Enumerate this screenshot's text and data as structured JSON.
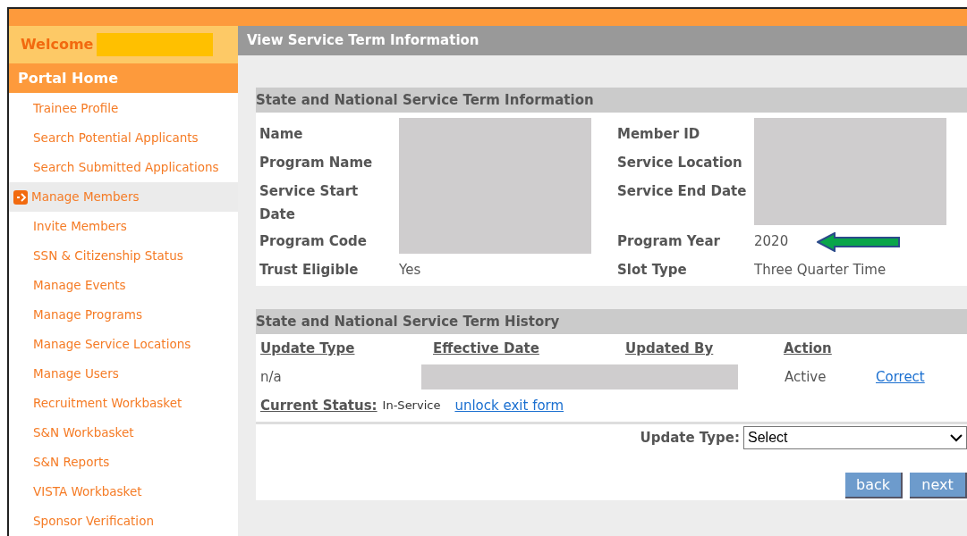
{
  "welcome": {
    "label": "Welcome",
    "name_redacted": true
  },
  "sidebar": {
    "home": "Portal Home",
    "items": [
      {
        "label": "Trainee Profile",
        "selected": false
      },
      {
        "label": "Search Potential Applicants",
        "selected": false
      },
      {
        "label": "Search Submitted Applications",
        "selected": false
      },
      {
        "label": "Manage Members",
        "selected": true
      },
      {
        "label": "Invite Members",
        "selected": false
      },
      {
        "label": "SSN & Citizenship Status",
        "selected": false
      },
      {
        "label": "Manage Events",
        "selected": false
      },
      {
        "label": "Manage Programs",
        "selected": false
      },
      {
        "label": "Manage Service Locations",
        "selected": false
      },
      {
        "label": "Manage Users",
        "selected": false
      },
      {
        "label": "Recruitment Workbasket",
        "selected": false
      },
      {
        "label": "S&N Workbasket",
        "selected": false
      },
      {
        "label": "S&N Reports",
        "selected": false
      },
      {
        "label": "VISTA Workbasket",
        "selected": false
      },
      {
        "label": "Sponsor Verification",
        "selected": false
      }
    ]
  },
  "page_title": "View Service Term Information",
  "info": {
    "title": "State and National Service Term Information",
    "left": [
      {
        "label": "Name",
        "redacted": true
      },
      {
        "label": "Program Name",
        "redacted": true
      },
      {
        "label": "Service Start Date",
        "redacted": true
      },
      {
        "label": "Program Code",
        "redacted": true
      },
      {
        "label": "Trust Eligible",
        "value": "Yes",
        "redacted": false
      }
    ],
    "right": [
      {
        "label": "Member ID",
        "redacted": true
      },
      {
        "label": "Service Location",
        "redacted": true
      },
      {
        "label": "Service End Date",
        "redacted": true
      },
      {
        "label": "Program Year",
        "value": "2020",
        "redacted": false,
        "arrow": true
      },
      {
        "label": "Slot Type",
        "value": "Three Quarter Time",
        "redacted": false
      }
    ]
  },
  "history": {
    "title": "State and National Service Term History",
    "columns": [
      "Update Type",
      "Effective Date",
      "Updated By",
      "Action"
    ],
    "rows": [
      {
        "update_type": "n/a",
        "redacted": true,
        "action": "Active",
        "link": "Correct"
      }
    ],
    "status_label": "Current Status:",
    "status": "In-Service",
    "unlock_link": "unlock exit form",
    "update_type_label": "Update Type:",
    "select_value": "Select",
    "buttons": [
      "back",
      "next"
    ]
  }
}
